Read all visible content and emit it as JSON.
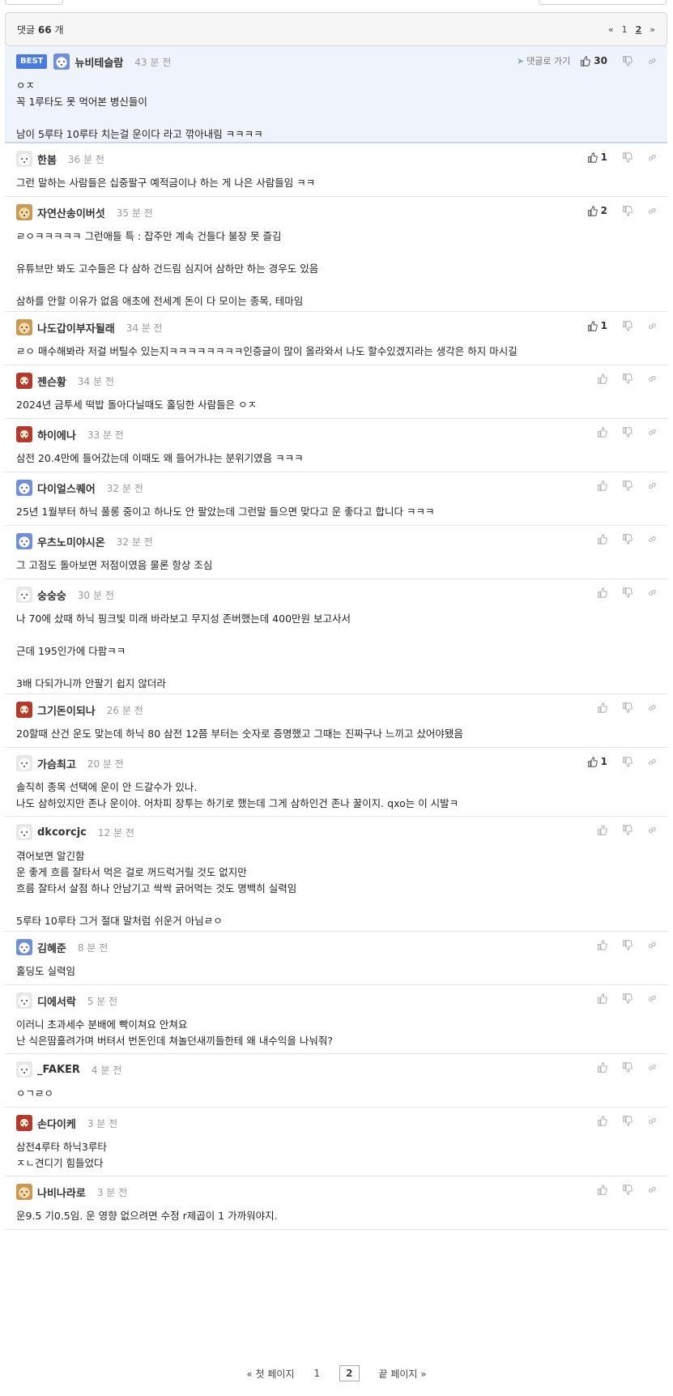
{
  "header": {
    "count_prefix": "댓글",
    "count": "66",
    "count_suffix": "개",
    "pager": {
      "prev": "«",
      "page1": "1",
      "page2": "2",
      "next": "»"
    }
  },
  "best": {
    "badge": "BEST",
    "reply_link": "댓글로 가기",
    "likes": "30",
    "nick": "뉴비테슬람",
    "time": "43 분 전",
    "body": "ㅇㅈ\n꼭 1루타도 못 먹어본 병신들이\n\n남이 5루타 10루타 치는걸 운이다 라고 깎아내림 ㅋㅋㅋㅋ"
  },
  "comments": [
    {
      "nick": "한봄",
      "time": "36 분 전",
      "likes": "1",
      "body": "그런 말하는 사람들은 십중팔구 예적금이나 하는 게 나은 사람들임 ㅋㅋ"
    },
    {
      "nick": "자연산송이버섯",
      "time": "35 분 전",
      "likes": "2",
      "body": "ㄹㅇㅋㅋㅋㅋㅋ 그런애들 특 : 잡주만 계속 건들다 불장 못 즐김\n\n유튜브만 봐도 고수들은 다 삼하 건드림 심지어 삼하만 하는 경우도 있음\n\n삼하를 안할 이유가 없음 애초에 전세계 돈이 다 모이는 종목, 테마임"
    },
    {
      "nick": "나도갑이부자될래",
      "time": "34 분 전",
      "likes": "1",
      "body": "ㄹㅇ 매수해봐라 저걸 버틸수 있는지ㅋㅋㅋㅋㅋㅋㅋㅋ인증글이 많이 올라와서 나도 할수있겠지라는 생각은 하지 마시길"
    },
    {
      "nick": "젠슨황",
      "time": "34 분 전",
      "likes": "",
      "body": "2024년 금투세 떡밥 돌아다닐때도 홀딩한 사람들은 ㅇㅈ"
    },
    {
      "nick": "하이에나",
      "time": "33 분 전",
      "likes": "",
      "body": "삼전 20.4만에 들어갔는데 이때도 왜 들어가냐는 분위기였음 ㅋㅋㅋ"
    },
    {
      "nick": "다이얼스퀘어",
      "time": "32 분 전",
      "likes": "",
      "body": "25년 1월부터 하닉 풀롱 중이고 하나도 안 팔았는데 그런말 들으면 맞다고 운 좋다고 합니다 ㅋㅋㅋ"
    },
    {
      "nick": "우츠노미야시온",
      "time": "32 분 전",
      "likes": "",
      "body": "그 고점도 돌아보면 저점이였음 물론 항상 조심"
    },
    {
      "nick": "숭숭숭",
      "time": "30 분 전",
      "likes": "",
      "body": "나 70에 샀때 하닉 핑크빛 미래 바라보고 무지성 존버했는데 400만원 보고사서\n\n근데 195인가에 다팜ㅋㅋ\n\n3배 다되가니까 안팔기 쉽지 않더라"
    },
    {
      "nick": "그기돈이되나",
      "time": "26 분 전",
      "likes": "",
      "body": "20할때 산건 운도 맞는데 하닉 80 삼전 12쯤 부터는 숫자로 증명했고 그때는 진짜구나 느끼고 샀어야됐음"
    },
    {
      "nick": "가슴최고",
      "time": "20 분 전",
      "likes": "1",
      "body": "솔직히 종목 선택에 운이 안 드갈수가 있나.\n나도 삼하있지만 존나 운이야. 어차피 장투는 하기로 했는데 그게 삼하인건 존나 꿀이지. qxo는 이 시발ㅋ"
    },
    {
      "nick": "dkcorcjc",
      "time": "12 분 전",
      "likes": "",
      "body": "겪어보면 알긴함\n운 좋게 흐름 잘타서 먹은 걸로 꺼드럭거릴 것도 없지만\n흐름 잘타서 살점 하나 안남기고 싹싹 긁어먹는 것도 명백히 실력임\n\n5루타 10루타 그거 절대 말처럼 쉬운거 아님ㄹㅇ"
    },
    {
      "nick": "김혜준",
      "time": "8 분 전",
      "likes": "",
      "body": "홀딩도 실력임"
    },
    {
      "nick": "디에서락",
      "time": "5 분 전",
      "likes": "",
      "body": "이러니 초과세수 분배에 빡이쳐요 안쳐요\n난 식은땀흘려가며 버텨서 번돈인데 쳐놀던새끼들한테 왜 내수익을 나눠줘?"
    },
    {
      "nick": "_FAKER",
      "time": "4 분 전",
      "likes": "",
      "body": "ㅇㄱㄹㅇ"
    },
    {
      "nick": "손다이케",
      "time": "3 분 전",
      "likes": "",
      "body": "삼전4루타 하닉3루타\nㅈㄴ견디기 힘들었다"
    },
    {
      "nick": "나비나라로",
      "time": "3 분 전",
      "likes": "",
      "body": "운9.5 기0.5임. 운 영향 없으려면 수정 r제곱이 1 가까워야지."
    }
  ],
  "bottom_pager": {
    "first": "« 첫 페이지",
    "page1": "1",
    "page2": "2",
    "last": "끝 페이지 »"
  }
}
